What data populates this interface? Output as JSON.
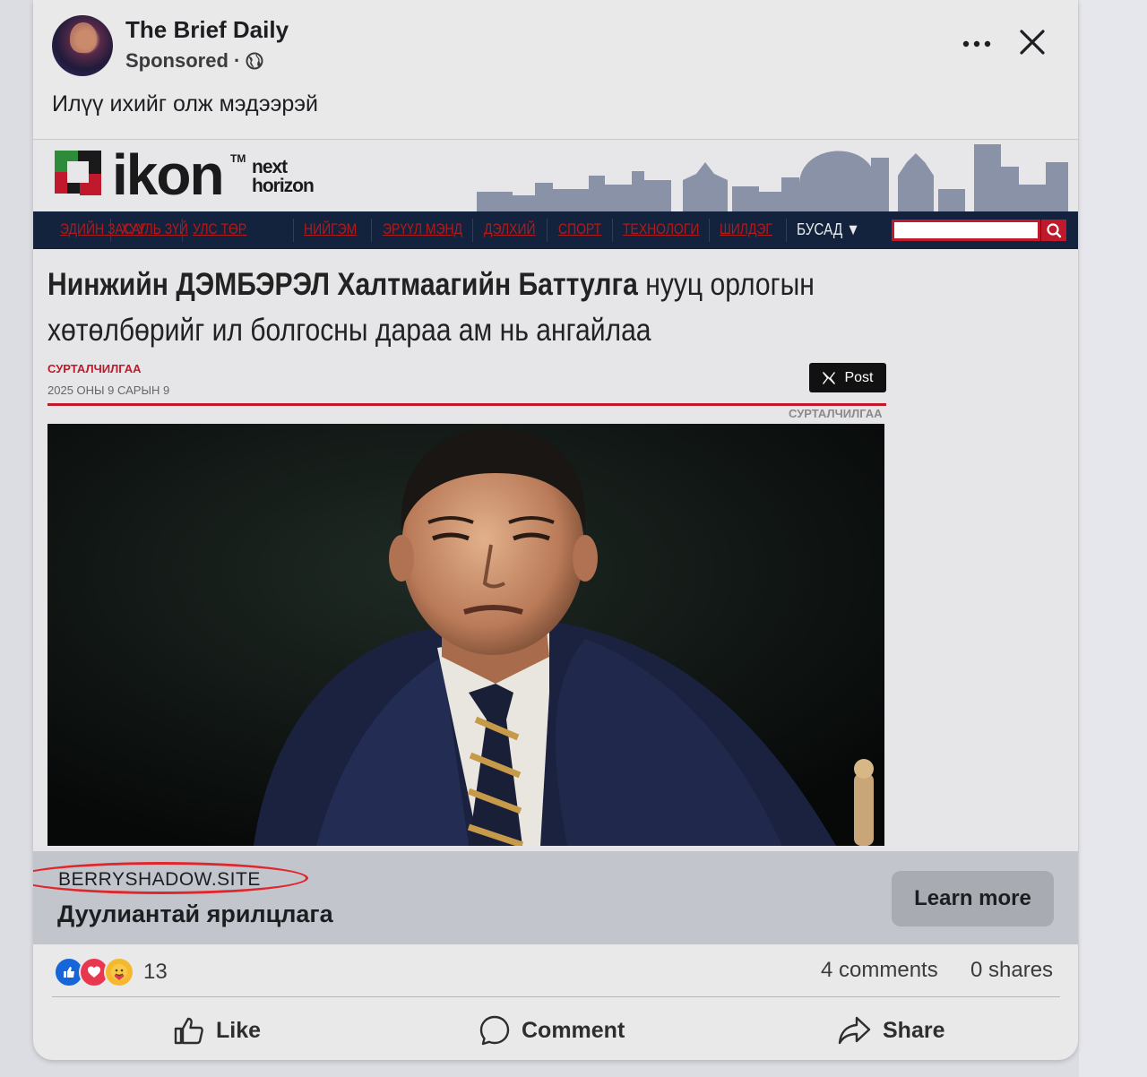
{
  "post": {
    "page_name": "The Brief Daily",
    "sponsored_label": "Sponsored ·",
    "caption": "Илүү ихийг олж мэдээрэй",
    "more_icon": "more-icon",
    "close_icon": "close-icon"
  },
  "creative": {
    "logo_word": "ikon",
    "logo_tm": "TM",
    "logo_tag_line1": "next",
    "logo_tag_line2": "horizon",
    "nav_items": [
      "ЭДИЙН ЗАСАГ",
      "ХУУЛЬ ЗҮЙ",
      "УЛС ТӨР",
      "НИЙГЭМ",
      "ЭРҮҮЛ МЭНД",
      "ДЭЛХИЙ",
      "СПОРТ",
      "ТЕХНОЛОГИ",
      "ШИЛДЭГ"
    ],
    "nav_more": "БУСАД ▼",
    "headline_bold": "Нинжийн ДЭМБЭРЭЛ Халтмаагийн Баттулга",
    "headline_rest": " нууц орлогын хөтөлбөрийг ил болгосны дараа ам нь ангайлаа",
    "category": "СУРТАЛЧИЛГАА",
    "date": "2025 ОНЫ 9 САРЫН 9",
    "x_post_label": "Post",
    "category_right": "СУРТАЛЧИЛГАА"
  },
  "link": {
    "domain": "BERRYSHADOW.SITE",
    "title": "Дуулиантай ярилцлага",
    "cta": "Learn more"
  },
  "engagement": {
    "reaction_count": "13",
    "comments": "4 comments",
    "shares": "0 shares"
  },
  "actions": {
    "like": "Like",
    "comment": "Comment",
    "share": "Share"
  },
  "colors": {
    "accent_red": "#c0192b",
    "nav_bg": "#13233d",
    "like_blue": "#1766d9"
  }
}
